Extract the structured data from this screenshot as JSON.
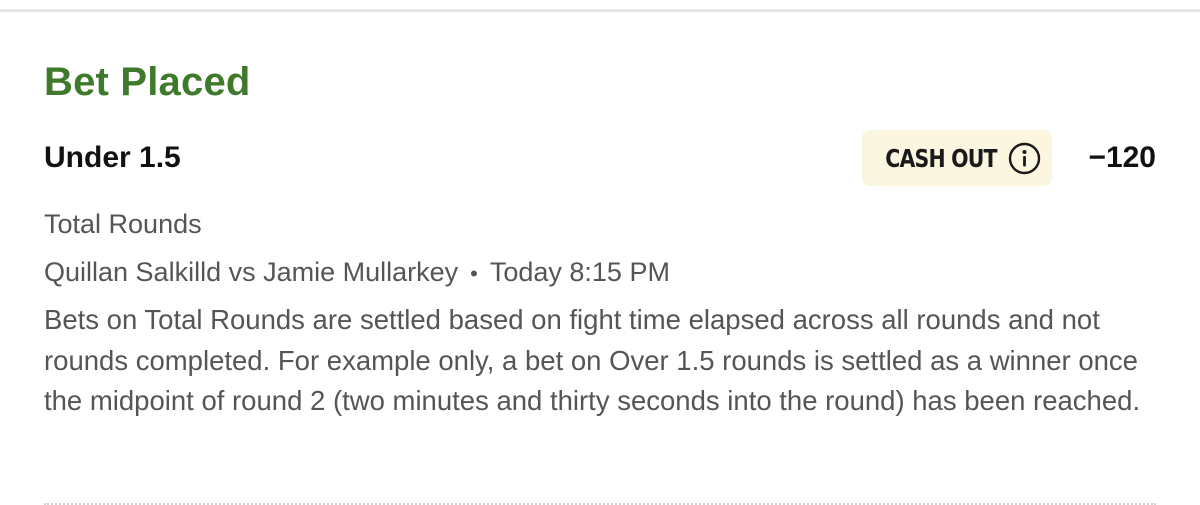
{
  "bet": {
    "status_title": "Bet Placed",
    "selection": "Under 1.5",
    "cash_out_label": "CASH OUT",
    "odds": "−120",
    "market": "Total Rounds",
    "event": {
      "matchup": "Quillan Salkilld vs Jamie Mullarkey",
      "separator": "•",
      "time": "Today 8:15 PM"
    },
    "rules_text": "Bets on Total Rounds are settled based on fight time elapsed across all rounds and not rounds completed. For example only, a bet on Over 1.5 rounds is settled as a winner once the midpoint of round 2 (two minutes and thirty seconds into the round) has been reached."
  },
  "icons": {
    "cash_out_info": "info-icon"
  },
  "colors": {
    "status_green": "#3f7a2c",
    "cash_out_bg": "#fbf6df",
    "secondary_text": "#555555",
    "primary_text": "#111111"
  }
}
